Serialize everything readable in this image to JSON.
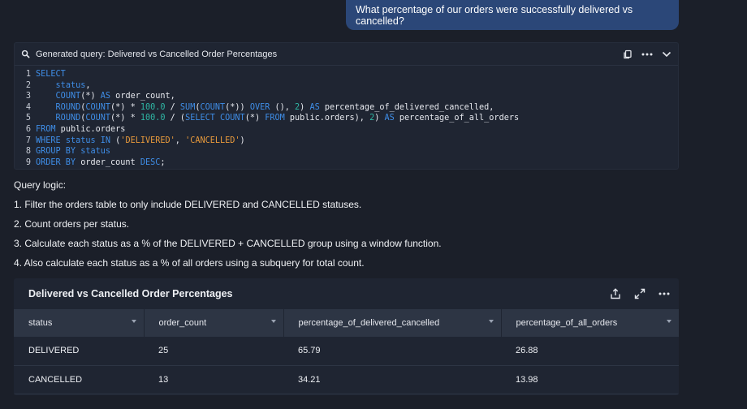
{
  "user_message": "What percentage of our orders were successfully delivered vs cancelled?",
  "query_card": {
    "title": "Generated query: Delivered vs Cancelled Order Percentages",
    "icons": [
      "search-icon",
      "copy-icon",
      "more-icon",
      "chevron-down-icon"
    ]
  },
  "code": {
    "line_numbers": [
      "1",
      "2",
      "3",
      "4",
      "5",
      "6",
      "7",
      "8",
      "9"
    ],
    "lines": [
      [
        {
          "t": "kw",
          "v": "SELECT"
        }
      ],
      [
        {
          "t": "id",
          "v": "    "
        },
        {
          "t": "kw",
          "v": "status"
        },
        {
          "t": "op",
          "v": ","
        }
      ],
      [
        {
          "t": "id",
          "v": "    "
        },
        {
          "t": "fn",
          "v": "COUNT"
        },
        {
          "t": "op",
          "v": "(*) "
        },
        {
          "t": "kw",
          "v": "AS"
        },
        {
          "t": "id",
          "v": " order_count,"
        }
      ],
      [
        {
          "t": "id",
          "v": "    "
        },
        {
          "t": "fn",
          "v": "ROUND"
        },
        {
          "t": "op",
          "v": "("
        },
        {
          "t": "fn",
          "v": "COUNT"
        },
        {
          "t": "op",
          "v": "(*) * "
        },
        {
          "t": "num",
          "v": "100.0"
        },
        {
          "t": "op",
          "v": " / "
        },
        {
          "t": "fn",
          "v": "SUM"
        },
        {
          "t": "op",
          "v": "("
        },
        {
          "t": "fn",
          "v": "COUNT"
        },
        {
          "t": "op",
          "v": "(*)) "
        },
        {
          "t": "kw",
          "v": "OVER"
        },
        {
          "t": "op",
          "v": " (), "
        },
        {
          "t": "num",
          "v": "2"
        },
        {
          "t": "op",
          "v": ") "
        },
        {
          "t": "kw",
          "v": "AS"
        },
        {
          "t": "id",
          "v": " percentage_of_delivered_cancelled,"
        }
      ],
      [
        {
          "t": "id",
          "v": "    "
        },
        {
          "t": "fn",
          "v": "ROUND"
        },
        {
          "t": "op",
          "v": "("
        },
        {
          "t": "fn",
          "v": "COUNT"
        },
        {
          "t": "op",
          "v": "(*) * "
        },
        {
          "t": "num",
          "v": "100.0"
        },
        {
          "t": "op",
          "v": " / ("
        },
        {
          "t": "kw",
          "v": "SELECT"
        },
        {
          "t": "op",
          "v": " "
        },
        {
          "t": "fn",
          "v": "COUNT"
        },
        {
          "t": "op",
          "v": "(*) "
        },
        {
          "t": "kw",
          "v": "FROM"
        },
        {
          "t": "id",
          "v": " public.orders), "
        },
        {
          "t": "num",
          "v": "2"
        },
        {
          "t": "op",
          "v": ") "
        },
        {
          "t": "kw",
          "v": "AS"
        },
        {
          "t": "id",
          "v": " percentage_of_all_orders"
        }
      ],
      [
        {
          "t": "kw",
          "v": "FROM"
        },
        {
          "t": "id",
          "v": " public.orders"
        }
      ],
      [
        {
          "t": "kw",
          "v": "WHERE"
        },
        {
          "t": "id",
          "v": " "
        },
        {
          "t": "kw",
          "v": "status"
        },
        {
          "t": "op",
          "v": " "
        },
        {
          "t": "kw",
          "v": "IN"
        },
        {
          "t": "op",
          "v": " ("
        },
        {
          "t": "str",
          "v": "'DELIVERED'"
        },
        {
          "t": "op",
          "v": ", "
        },
        {
          "t": "str",
          "v": "'CANCELLED'"
        },
        {
          "t": "op",
          "v": ")"
        }
      ],
      [
        {
          "t": "kw",
          "v": "GROUP BY"
        },
        {
          "t": "id",
          "v": " "
        },
        {
          "t": "kw",
          "v": "status"
        }
      ],
      [
        {
          "t": "kw",
          "v": "ORDER BY"
        },
        {
          "t": "id",
          "v": " order_count "
        },
        {
          "t": "kw",
          "v": "DESC"
        },
        {
          "t": "op",
          "v": ";"
        }
      ]
    ]
  },
  "logic": {
    "heading": "Query logic:",
    "steps": [
      "1. Filter the orders table to only include DELIVERED and CANCELLED statuses.",
      "2. Count orders per status.",
      "3. Calculate each status as a % of the DELIVERED + CANCELLED group using a window function.",
      "4. Also calculate each status as a % of all orders using a subquery for total count."
    ]
  },
  "result": {
    "title": "Delivered vs Cancelled Order Percentages",
    "icons": [
      "share-icon",
      "expand-icon",
      "more-icon"
    ],
    "columns": [
      "status",
      "order_count",
      "percentage_of_delivered_cancelled",
      "percentage_of_all_orders"
    ],
    "rows": [
      [
        "DELIVERED",
        "25",
        "65.79",
        "26.88"
      ],
      [
        "CANCELLED",
        "13",
        "34.21",
        "13.98"
      ]
    ]
  },
  "colors": {
    "background": "#1b1f29",
    "card": "#1f2532",
    "user_bubble": "#2b4778",
    "table_header": "#2d3544",
    "keyword": "#3f8ee8",
    "number": "#2fb6a4",
    "string": "#e89a3c"
  }
}
